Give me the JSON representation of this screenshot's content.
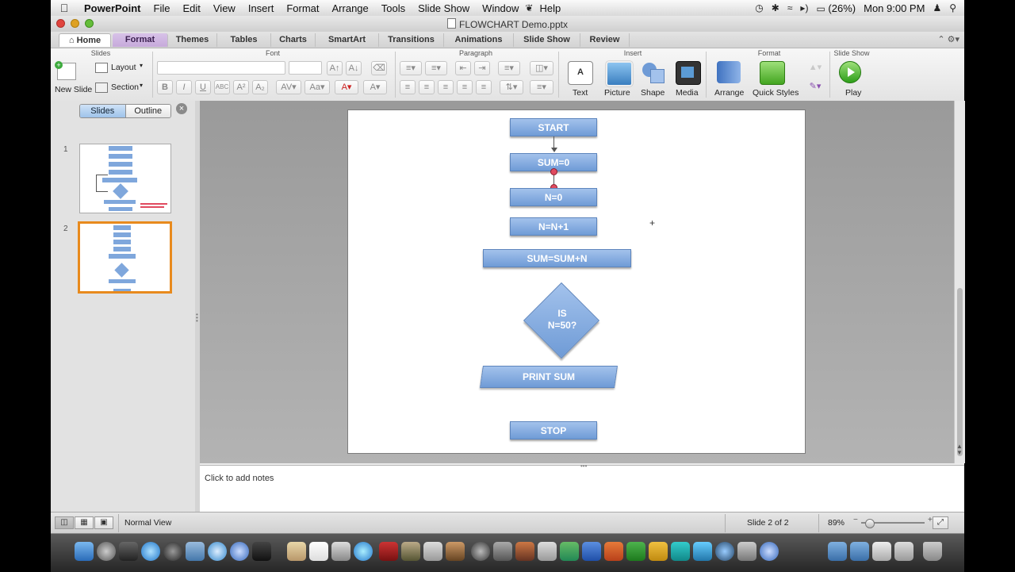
{
  "menubar": {
    "app": "PowerPoint",
    "items": [
      "File",
      "Edit",
      "View",
      "Insert",
      "Format",
      "Arrange",
      "Tools",
      "Slide Show",
      "Window",
      "Help"
    ],
    "battery": "(26%)",
    "clock": "Mon 9:00 PM"
  },
  "window": {
    "title": "FLOWCHART Demo.pptx"
  },
  "ribbon_tabs": [
    "Home",
    "Format",
    "Themes",
    "Tables",
    "Charts",
    "SmartArt",
    "Transitions",
    "Animations",
    "Slide Show",
    "Review"
  ],
  "ribbon": {
    "groups": {
      "slides": "Slides",
      "font": "Font",
      "paragraph": "Paragraph",
      "insert": "Insert",
      "format": "Format",
      "slideshow": "Slide Show"
    },
    "new_slide": "New Slide",
    "layout": "Layout",
    "section": "Section",
    "insert_text": "Text",
    "insert_picture": "Picture",
    "insert_shape": "Shape",
    "insert_media": "Media",
    "arrange": "Arrange",
    "quick_styles": "Quick Styles",
    "play": "Play"
  },
  "left_panel": {
    "tab_slides": "Slides",
    "tab_outline": "Outline",
    "slide_numbers": [
      "1",
      "2"
    ]
  },
  "flowchart": {
    "start": "START",
    "sum0": "SUM=0",
    "n0": "N=0",
    "nn1": "N=N+1",
    "sumsum": "SUM=SUM+N",
    "decision_line1": "IS",
    "decision_line2": "N=50?",
    "print": "PRINT SUM",
    "stop": "STOP"
  },
  "notes": {
    "placeholder": "Click to add notes"
  },
  "status": {
    "view": "Normal View",
    "slide_counter": "Slide 2 of 2",
    "zoom": "89%"
  },
  "colors": {
    "shape_fill": "#7fa7dc",
    "selection": "#e88a1d",
    "format_tab": "#c7aadb"
  }
}
